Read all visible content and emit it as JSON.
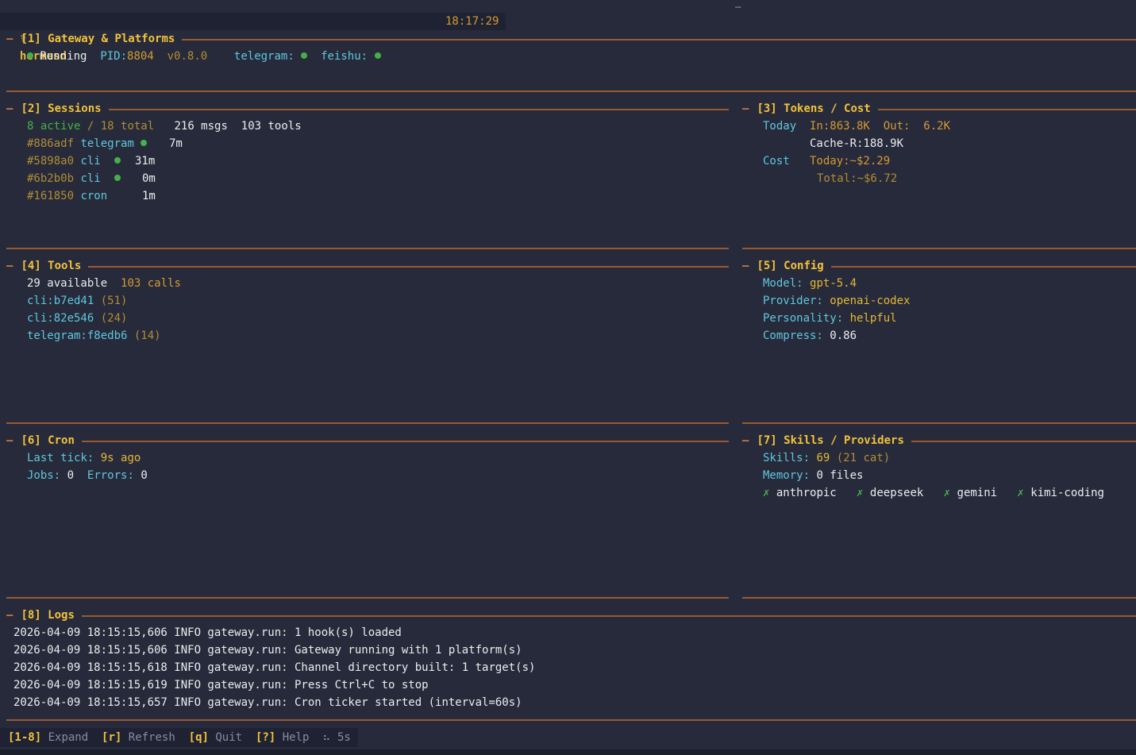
{
  "header": {
    "icon": "⚕",
    "app": "hermesd",
    "time": "18:17:29",
    "menu": "⋯"
  },
  "gateway": {
    "title": "[1] Gateway & Platforms",
    "status": "Running",
    "pid_label": "PID:",
    "pid": "8804",
    "version": "v0.8.0",
    "platforms": [
      {
        "name": "telegram:",
        "status_color": "#45b04a"
      },
      {
        "name": "feishu:",
        "status_color": "#45b04a"
      }
    ]
  },
  "sessions": {
    "title": "[2] Sessions",
    "active": "8 active",
    "total": "/ 18 total",
    "msgs": "216 msgs",
    "tools": "103 tools",
    "rows": [
      {
        "id": "#886adf",
        "platform": "telegram",
        "time": "7m",
        "online": true
      },
      {
        "id": "#5898a0",
        "platform": "cli",
        "time": "31m",
        "online": true
      },
      {
        "id": "#6b2b0b",
        "platform": "cli",
        "time": "0m",
        "online": true
      },
      {
        "id": "#161850",
        "platform": "cron",
        "time": "1m",
        "online": false
      }
    ]
  },
  "tokens": {
    "title": "[3] Tokens / Cost",
    "today_label": "Today",
    "in": "In:863.8K",
    "out_label": "Out:",
    "out": "6.2K",
    "cache": "Cache-R:188.9K",
    "cost_label": "Cost",
    "cost_today": "Today:~$2.29",
    "cost_total": "Total:~$6.72"
  },
  "tools": {
    "title": "[4] Tools",
    "available": "29 available",
    "calls": "103 calls",
    "items": [
      {
        "name": "cli:b7ed41",
        "count": "(51)"
      },
      {
        "name": "cli:82e546",
        "count": "(24)"
      },
      {
        "name": "telegram:f8edb6",
        "count": "(14)"
      }
    ]
  },
  "config": {
    "title": "[5] Config",
    "model_label": "Model:",
    "model": "gpt-5.4",
    "provider_label": "Provider:",
    "provider": "openai-codex",
    "personality_label": "Personality:",
    "personality": "helpful",
    "compress_label": "Compress:",
    "compress": "0.86"
  },
  "cron": {
    "title": "[6] Cron",
    "last_tick_label": "Last tick:",
    "last_tick": "9s ago",
    "jobs_label": "Jobs:",
    "jobs": "0",
    "errors_label": "Errors:",
    "errors": "0"
  },
  "skills": {
    "title": "[7] Skills / Providers",
    "skills_label": "Skills:",
    "skills": "69",
    "cat": "(21 cat)",
    "memory_label": "Memory:",
    "memory_count": "0",
    "memory_unit": "files",
    "providers": [
      {
        "mark": "✗",
        "name": "anthropic"
      },
      {
        "mark": "✗",
        "name": "deepseek"
      },
      {
        "mark": "✗",
        "name": "gemini"
      },
      {
        "mark": "✗",
        "name": "kimi-coding"
      }
    ]
  },
  "logs": {
    "title": "[8] Logs",
    "lines": [
      "2026-04-09 18:15:15,606 INFO gateway.run: 1 hook(s) loaded",
      "2026-04-09 18:15:15,606 INFO gateway.run: Gateway running with 1 platform(s)",
      "2026-04-09 18:15:15,618 INFO gateway.run: Channel directory built: 1 target(s)",
      "2026-04-09 18:15:15,619 INFO gateway.run: Press Ctrl+C to stop",
      "2026-04-09 18:15:15,657 INFO gateway.run: Cron ticker started (interval=60s)"
    ]
  },
  "footer": {
    "expand_key": "[1-8]",
    "expand": "Expand",
    "refresh_key": "[r]",
    "refresh": "Refresh",
    "quit_key": "[q]",
    "quit": "Quit",
    "help_key": "[?]",
    "help": "Help",
    "spinner": "⠦",
    "interval": "5s"
  }
}
